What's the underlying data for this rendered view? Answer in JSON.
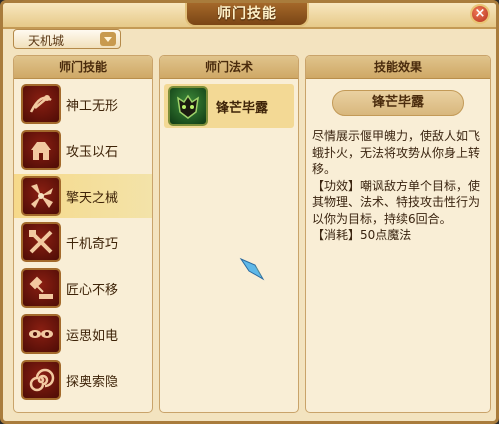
{
  "window": {
    "title": "师门技能",
    "close_glyph": "×"
  },
  "city_select": {
    "value": "天机城"
  },
  "panels": {
    "skills_header": "师门技能",
    "spells_header": "师门法术",
    "effect_header": "技能效果"
  },
  "skills": [
    {
      "label": "神工无形",
      "icon": "hammer-swirl-icon"
    },
    {
      "label": "攻玉以石",
      "icon": "stone-altar-icon"
    },
    {
      "label": "擎天之械",
      "icon": "machine-fan-icon",
      "selected": true
    },
    {
      "label": "千机奇巧",
      "icon": "crossed-tools-icon"
    },
    {
      "label": "匠心不移",
      "icon": "anvil-hammer-icon"
    },
    {
      "label": "运思如电",
      "icon": "eyes-icon"
    },
    {
      "label": "探奥索隐",
      "icon": "spiral-icon"
    }
  ],
  "spells": [
    {
      "label": "锋芒毕露",
      "icon": "demon-mask-icon"
    }
  ],
  "effect": {
    "name": "锋芒毕露",
    "description": "尽情展示偃甲魄力，使敌人如飞蛾扑火，无法将攻势从你身上转移。",
    "effect_line": "【功效】嘲讽敌方单个目标，使其物理、法术、特技攻击性行为以你为目标，持续6回合。",
    "cost_line": "【消耗】50点魔法"
  },
  "colors": {
    "accent": "#a97c3c",
    "panel_bg": "#f9eed6",
    "selected_bg": "#f6d98a",
    "icon_red": "#8a1f12"
  }
}
